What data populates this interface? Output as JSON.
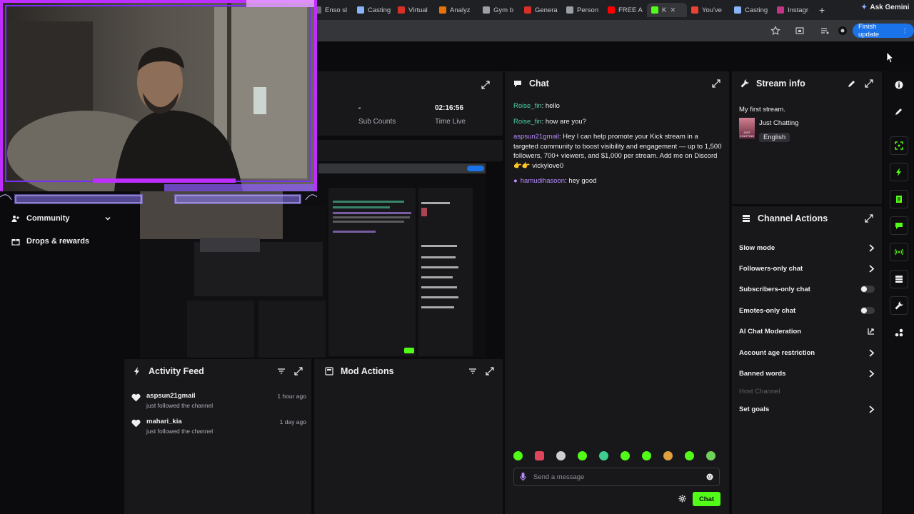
{
  "browser": {
    "tabs": [
      {
        "label": "Enso sl",
        "color": "#6b6b6b"
      },
      {
        "label": "Casting",
        "color": "#8ab4f8"
      },
      {
        "label": "Virtual",
        "color": "#d93025"
      },
      {
        "label": "Analyz",
        "color": "#e8710a"
      },
      {
        "label": "Gym b",
        "color": "#9aa0a6"
      },
      {
        "label": "Genera",
        "color": "#d93025"
      },
      {
        "label": "Person",
        "color": "#9aa0a6"
      },
      {
        "label": "FREE A",
        "color": "#ff0000"
      },
      {
        "label": "K",
        "color": "#53fc18"
      },
      {
        "label": "You've",
        "color": "#ea4335"
      },
      {
        "label": "Casting",
        "color": "#8ab4f8"
      },
      {
        "label": "Instagr",
        "color": "#c13584"
      }
    ],
    "ask_gemini": "Ask Gemini",
    "finish_update": "Finish update"
  },
  "stats": {
    "sub_counts_value": "-",
    "sub_counts_label": "Sub Counts",
    "time_live_value": "02:16:56",
    "time_live_label": "Time Live"
  },
  "nav": {
    "community": "Community",
    "drops": "Drops & rewards"
  },
  "chat": {
    "title": "Chat",
    "messages": [
      {
        "user": "Roise_fin",
        "text": ": hello"
      },
      {
        "user": "Roise_fin",
        "text": ": how are you?"
      },
      {
        "user": "aspsun21gmail",
        "text": ": Hey I can help promote your Kick stream in a targeted community to boost visibility and engagement — up to 1,500 followers, 700+ viewers, and $1,000 per stream. Add me on Discord👉👉 vickylove0"
      },
      {
        "user": "hamudihasoon",
        "text": ": hey good"
      }
    ],
    "input_placeholder": "Send a message",
    "send_label": "Chat"
  },
  "stream_info": {
    "title": "Stream info",
    "stream_title": "My first stream.",
    "category": "Just Chatting",
    "language": "English",
    "thumb_text": "JUST CHATTING"
  },
  "channel_actions": {
    "title": "Channel Actions",
    "items": [
      {
        "label": "Slow mode",
        "control": "chevron"
      },
      {
        "label": "Followers-only chat",
        "control": "chevron"
      },
      {
        "label": "Subscribers-only chat",
        "control": "toggle",
        "on": false
      },
      {
        "label": "Emotes-only chat",
        "control": "toggle",
        "on": false
      },
      {
        "label": "AI Chat Moderation",
        "control": "external"
      },
      {
        "label": "Account age restriction",
        "control": "chevron"
      },
      {
        "label": "Banned words",
        "control": "chevron"
      },
      {
        "label": "Host Channel",
        "control": "none",
        "disabled": true
      },
      {
        "label": "Set goals",
        "control": "chevron"
      }
    ]
  },
  "activity_feed": {
    "title": "Activity Feed",
    "items": [
      {
        "user": "aspsun21gmail",
        "action": "just followed the channel",
        "time": "1 hour ago"
      },
      {
        "user": "mahari_kia",
        "action": "just followed the channel",
        "time": "1 day ago"
      }
    ]
  },
  "mod_actions": {
    "title": "Mod Actions"
  },
  "colors": {
    "accent": "#53fc18",
    "panel": "#18181b",
    "background": "#0b0b0d"
  }
}
